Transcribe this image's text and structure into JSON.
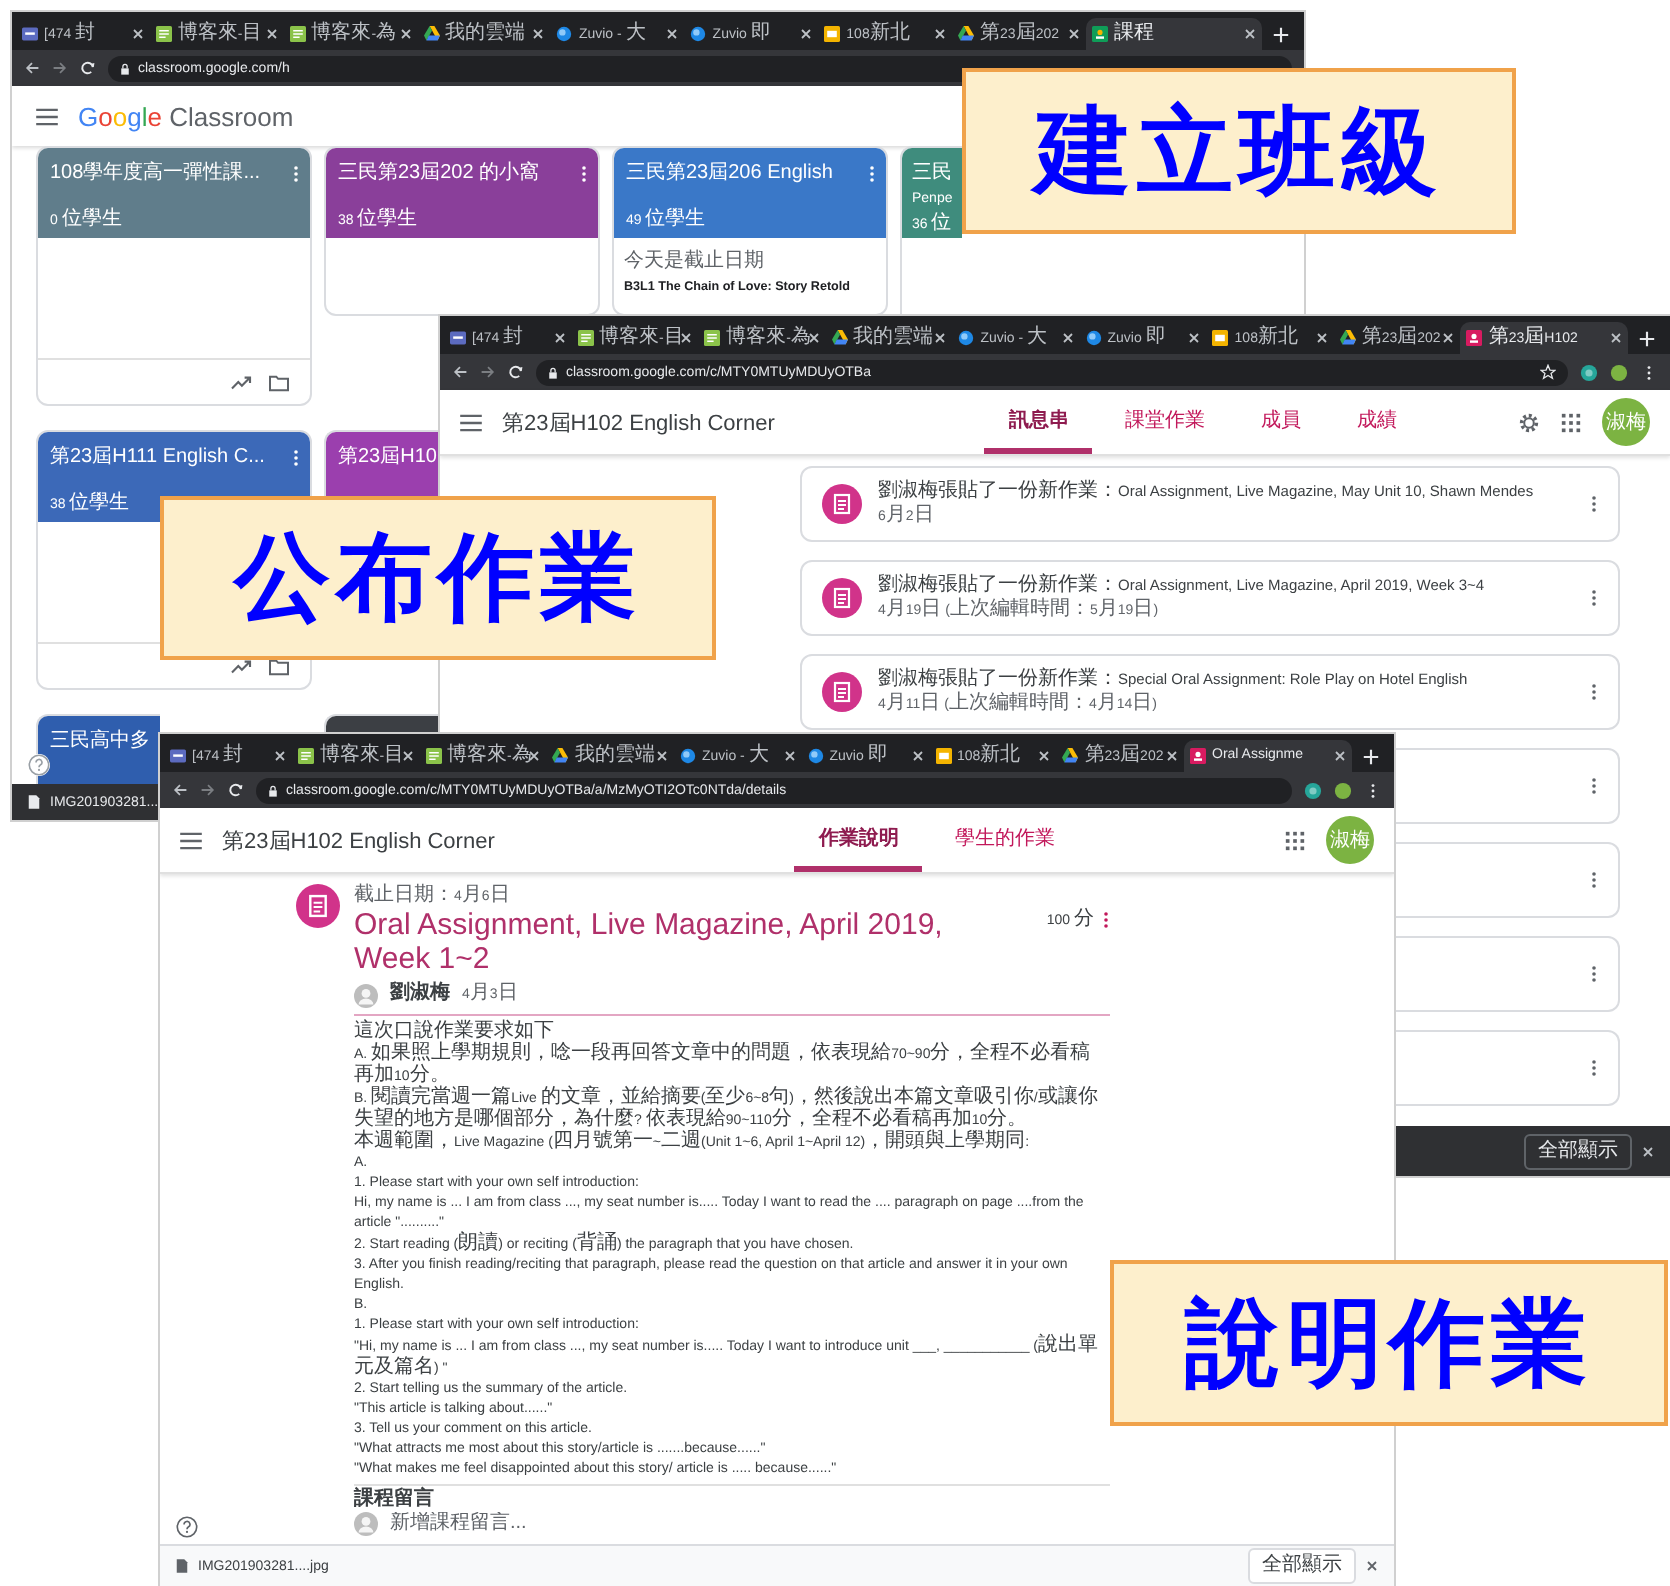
{
  "classes_window": {
    "tabs": [
      {
        "label": "[474 封",
        "kind": "mail",
        "selected": false
      },
      {
        "label": "博客來-目",
        "kind": "books",
        "selected": false
      },
      {
        "label": "博客來-為",
        "kind": "books",
        "selected": false
      },
      {
        "label": "我的雲端",
        "kind": "drive",
        "selected": false
      },
      {
        "label": "Zuvio - 大",
        "kind": "zuvio",
        "selected": false
      },
      {
        "label": "Zuvio 即",
        "kind": "zuvio",
        "selected": false
      },
      {
        "label": "108新北",
        "kind": "slides",
        "selected": false
      },
      {
        "label": "第23屆202",
        "kind": "drive",
        "selected": false
      },
      {
        "label": "課程",
        "kind": "classroom-green",
        "selected": true
      }
    ],
    "url": "classroom.google.com/h",
    "logo": {
      "brand": "Google",
      "product": "Classroom"
    },
    "card_rows": [
      [
        {
          "title": "108學年度高一彈性課...",
          "students": "0 位學生",
          "color": "#607d8b",
          "menu": true,
          "footer": true
        },
        {
          "title": "三民第23屆202 的小窩",
          "students": "38 位學生",
          "color": "#8a3f9a",
          "menu": true,
          "footer": false
        },
        {
          "title": "三民第23屆206 English",
          "students": "49 位學生",
          "color": "#3a78c8",
          "menu": true,
          "footer": false,
          "body": [
            "今天是截止日期",
            "B3L1 The Chain of Love: Story Retold"
          ]
        },
        {
          "title": "三民",
          "subtitle": "Penpe",
          "students": "36 位",
          "color": "#3f8c7d",
          "menu": false
        }
      ],
      [
        {
          "title": "第23屆H111 English C...",
          "students": "38 位學生",
          "color": "#3c69b8",
          "menu": true,
          "footer": true
        },
        {
          "title": "第23屆H10",
          "color": "#9b3fae"
        }
      ],
      [
        {
          "title": "三民高中多",
          "color": "#2f5eae"
        },
        {
          "color": "#3c3f44"
        }
      ]
    ],
    "download": {
      "file": "IMG201903281..."
    }
  },
  "stream_window": {
    "tabs": [
      {
        "label": "[474 封",
        "kind": "mail",
        "selected": false
      },
      {
        "label": "博客來-目",
        "kind": "books",
        "selected": false
      },
      {
        "label": "博客來-為",
        "kind": "books",
        "selected": false
      },
      {
        "label": "我的雲端",
        "kind": "drive",
        "selected": false
      },
      {
        "label": "Zuvio - 大",
        "kind": "zuvio",
        "selected": false
      },
      {
        "label": "Zuvio 即",
        "kind": "zuvio",
        "selected": false
      },
      {
        "label": "108新北",
        "kind": "slides",
        "selected": false
      },
      {
        "label": "第23屆202",
        "kind": "drive",
        "selected": false
      },
      {
        "label": "第23屆H102",
        "kind": "classroom",
        "selected": true
      }
    ],
    "url": "classroom.google.com/c/MTY0MTUyMDUyOTBa",
    "course_title": "第23屆H102 English Corner",
    "nav": [
      {
        "label": "訊息串",
        "selected": true
      },
      {
        "label": "課堂作業",
        "selected": false
      },
      {
        "label": "成員",
        "selected": false
      },
      {
        "label": "成績",
        "selected": false
      }
    ],
    "avatar": "淑梅",
    "posts": [
      {
        "text": "劉淑梅張貼了一份新作業：Oral Assignment, Live Magazine, May Unit 10, Shawn Mendes",
        "date": "6月2日",
        "menu": true
      },
      {
        "text": "劉淑梅張貼了一份新作業：Oral Assignment, Live Magazine, April 2019, Week 3~4",
        "date": "4月19日 (上次編輯時間：5月19日)",
        "menu": true
      },
      {
        "text": "劉淑梅張貼了一份新作業：Special Oral Assignment: Role Play on Hotel English",
        "date": "4月11日 (上次編輯時間：4月14日)",
        "menu": true
      },
      {
        "menu": true
      },
      {
        "menu": true
      },
      {
        "menu": true
      },
      {
        "menu": true
      }
    ],
    "download": {
      "show_all": "全部顯示"
    }
  },
  "assignment_window": {
    "tabs": [
      {
        "label": "[474 封",
        "kind": "mail",
        "selected": false
      },
      {
        "label": "博客來-目",
        "kind": "books",
        "selected": false
      },
      {
        "label": "博客來-為",
        "kind": "books",
        "selected": false
      },
      {
        "label": "我的雲端",
        "kind": "drive",
        "selected": false
      },
      {
        "label": "Zuvio - 大",
        "kind": "zuvio",
        "selected": false
      },
      {
        "label": "Zuvio 即",
        "kind": "zuvio",
        "selected": false
      },
      {
        "label": "108新北",
        "kind": "slides",
        "selected": false
      },
      {
        "label": "第23屆202",
        "kind": "drive",
        "selected": false
      },
      {
        "label": "Oral Assignme",
        "kind": "classroom",
        "selected": true
      }
    ],
    "url": "classroom.google.com/c/MTY0MTUyMDUyOTBa/a/MzMyOTI2OTc0NTda/details",
    "course_title": "第23屆H102 English Corner",
    "nav": [
      {
        "label": "作業說明",
        "selected": true
      },
      {
        "label": "學生的作業",
        "selected": false
      }
    ],
    "avatar": "淑梅",
    "due": "截止日期：4月6日",
    "title": "Oral Assignment, Live Magazine, April 2019, Week 1~2",
    "points": "100 分",
    "author": "劉淑梅",
    "posted": "4月3日",
    "description": [
      "這次口說作業要求如下",
      "A. 如果照上學期規則，唸一段再回答文章中的問題，依表現給70~90分，全程不必看稿再加10分。",
      "B. 閱讀完當週一篇Live 的文章，並給摘要(至少6~8句)，然後說出本篇文章吸引你/或讓你失望的地方是哪個部分，為什麼? 依表現給90~110分，全程不必看稿再加10分。",
      "本週範圍，Live Magazine (四月號第一~二週(Unit 1~6, April 1~April 12)，開頭與上學期同:",
      "A.",
      "1. Please start with your own self introduction:",
      "Hi, my name is ... I am from class ..., my seat number is..... Today I want to read the .... paragraph on page ....from the article \"..........\"",
      "2. Start reading (朗讀) or reciting (背誦) the paragraph that you have chosen.",
      "3. After you finish reading/reciting that paragraph, please read the question on that article and answer it in your own English.",
      "B.",
      "1. Please start with your own self introduction:",
      "\"Hi, my name is ... I am from class ..., my seat number is..... Today I want to introduce unit ___, ___________ (說出單元及篇名) \"",
      "2. Start telling us the summary of the article.",
      "\"This article is talking about......\"",
      "3. Tell us your comment on this article.",
      "\"What attracts me most about this story/article is .......because......\"",
      "\"What makes me feel disappointed about this story/ article is ..... because......\""
    ],
    "comments_heading": "課程留言",
    "comment": {
      "placeholder": "新增課程留言..."
    },
    "download": {
      "file": "IMG201903281....jpg",
      "show_all": "全部顯示"
    }
  },
  "callouts": [
    {
      "text": "建立班級"
    },
    {
      "text": "公布作業"
    },
    {
      "text": "說明作業"
    }
  ]
}
